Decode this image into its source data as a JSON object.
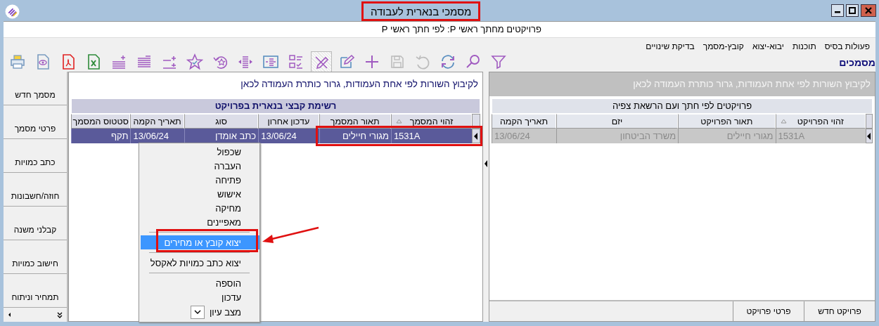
{
  "window": {
    "title": "מסמכי בנארית לעבודה",
    "highlighted": true
  },
  "subtitle": "פרויקטים מחתך ראשי P: לפי חתך ראשי P",
  "menu_bar": [
    "פעולות בסיס",
    "תוכנות",
    "יבוא-יצוא",
    "קובץ-מסמך",
    "בדיקת שינויים"
  ],
  "section_title": "מסמכים",
  "toolbar": [
    {
      "kind": "filter",
      "disabled": false,
      "selected": false
    },
    {
      "kind": "search",
      "disabled": false,
      "selected": false
    },
    {
      "kind": "refresh",
      "disabled": false,
      "selected": false
    },
    {
      "kind": "undo",
      "disabled": true,
      "selected": false
    },
    {
      "kind": "save",
      "disabled": true,
      "selected": false
    },
    {
      "kind": "plus",
      "disabled": false,
      "selected": false
    },
    {
      "kind": "edit",
      "disabled": false,
      "selected": false
    },
    {
      "kind": "pencil-cross",
      "disabled": false,
      "selected": true
    },
    {
      "kind": "checklist",
      "disabled": false,
      "selected": false
    },
    {
      "kind": "frame",
      "disabled": false,
      "selected": false
    },
    {
      "kind": "align",
      "disabled": false,
      "selected": false
    },
    {
      "kind": "star-undo",
      "disabled": false,
      "selected": false
    },
    {
      "kind": "star",
      "disabled": false,
      "selected": false
    },
    {
      "kind": "lines-plus",
      "disabled": false,
      "selected": false
    },
    {
      "kind": "lines",
      "disabled": false,
      "selected": false
    },
    {
      "kind": "lines-plus2",
      "disabled": false,
      "selected": false
    },
    {
      "kind": "excel",
      "disabled": false,
      "selected": false
    },
    {
      "kind": "pdf",
      "disabled": false,
      "selected": false
    },
    {
      "kind": "preview",
      "disabled": false,
      "selected": false
    },
    {
      "kind": "print",
      "disabled": false,
      "selected": false
    }
  ],
  "sidebar": {
    "items": [
      "מסמך חדש",
      "פרטי מסמך",
      "כתב כמויות",
      "חוזה/חשבונות",
      "קבלני משנה",
      "חישוב כמויות",
      "תמחיר וניתוח"
    ]
  },
  "documents": {
    "focused": true,
    "group_hint": "לקיבוץ השורות לפי אחת העמודות, גרור כותרת העמודה לכאן",
    "title": "רשימת קבצי בנארית בפרויקט",
    "columns": [
      {
        "label": "זהוי המסמך",
        "sorted": true
      },
      {
        "label": "תאור המסמך",
        "sorted": false
      },
      {
        "label": "עדכון אחרון",
        "sorted": false
      },
      {
        "label": "סוג",
        "sorted": false
      },
      {
        "label": "תאריך הקמה",
        "sorted": false
      },
      {
        "label": "סטטוס המסמך",
        "sorted": false
      }
    ],
    "rows": [
      {
        "selected": true,
        "highlighted": true,
        "cells": [
          "1531A",
          "מגורי חיילים",
          "13/06/24",
          "כתב אומדן",
          "13/06/24",
          "תקף"
        ]
      }
    ]
  },
  "projects": {
    "focused": false,
    "group_hint": "לקיבוץ השורות לפי אחת העמודות, גרור כותרת העמודה לכאן",
    "title": "פרויקטים לפי חתך ועם הרשאת צפיה",
    "columns": [
      {
        "label": "זהוי הפרויקט",
        "sorted": true
      },
      {
        "label": "תאור הפרויקט",
        "sorted": false
      },
      {
        "label": "יזם",
        "sorted": false
      },
      {
        "label": "תאריך הקמה",
        "sorted": false
      }
    ],
    "rows": [
      {
        "selected": true,
        "highlighted": false,
        "cells": [
          "1531A",
          "מגורי חיילים",
          "משרד הביטחון",
          "13/06/24"
        ]
      }
    ]
  },
  "project_tabs": [
    "פרויקט חדש",
    "פרטי פרויקט"
  ],
  "context_menu": {
    "items": [
      {
        "kind": "item",
        "label": "שכפול",
        "selected": false,
        "annotated": false
      },
      {
        "kind": "item",
        "label": "העברה",
        "selected": false,
        "annotated": false
      },
      {
        "kind": "item",
        "label": "פתיחה",
        "selected": false,
        "annotated": false
      },
      {
        "kind": "item",
        "label": "אישוש",
        "selected": false,
        "annotated": false
      },
      {
        "kind": "item",
        "label": "מחיקה",
        "selected": false,
        "annotated": false
      },
      {
        "kind": "item",
        "label": "מאפיינים",
        "selected": false,
        "annotated": false
      },
      {
        "kind": "separator"
      },
      {
        "kind": "item",
        "label": "יצוא קובץ או מחירים",
        "selected": true,
        "annotated": true
      },
      {
        "kind": "separator"
      },
      {
        "kind": "item",
        "label": "יצוא כתב כמויות לאקסל",
        "selected": false,
        "annotated": false
      },
      {
        "kind": "separator"
      },
      {
        "kind": "item",
        "label": "הוספה",
        "selected": false,
        "annotated": false
      },
      {
        "kind": "item",
        "label": "עדכון",
        "selected": false,
        "annotated": false
      },
      {
        "kind": "toggle",
        "label": "מצב עיון",
        "checked": true
      }
    ]
  }
}
